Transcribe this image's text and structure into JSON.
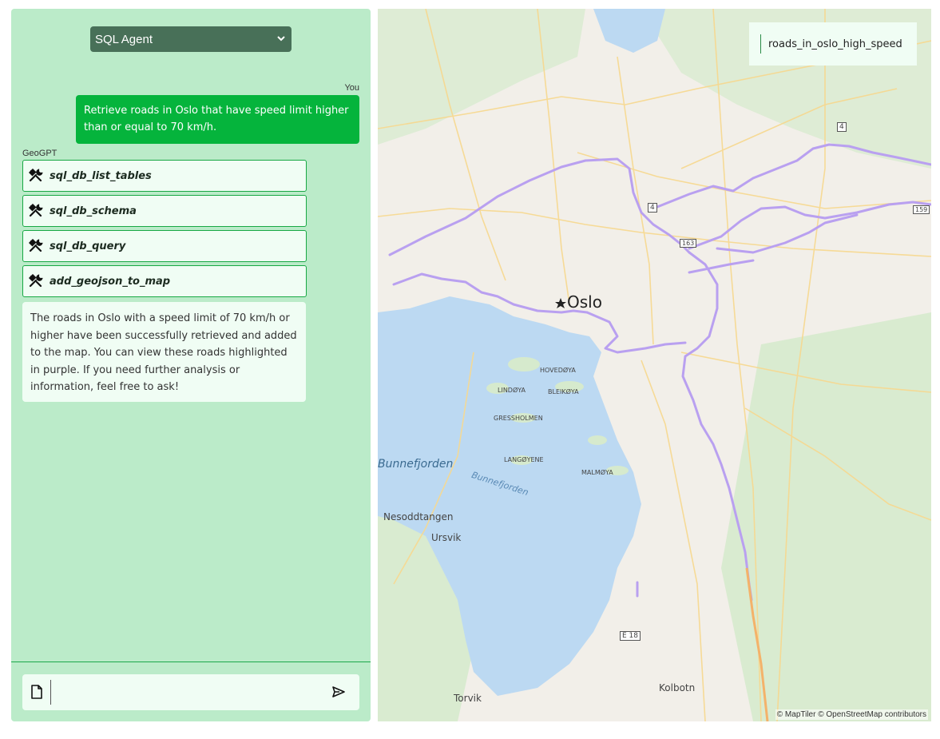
{
  "agent_select": {
    "value": "SQL Agent"
  },
  "chat": {
    "user_label": "You",
    "user_message": "Retrieve roads in Oslo that have speed limit higher than or equal to 70 km/h.",
    "bot_label": "GeoGPT",
    "tool_calls": [
      "sql_db_list_tables",
      "sql_db_schema",
      "sql_db_query",
      "add_geojson_to_map"
    ],
    "answer": "The roads in Oslo with a speed limit of 70 km/h or higher have been successfully retrieved and added to the map. You can view these roads highlighted in purple. If you need further analysis or information, feel free to ask!"
  },
  "input": {
    "placeholder": "",
    "value": ""
  },
  "map": {
    "layer_name": "roads_in_oslo_high_speed",
    "attribution": "© MapTiler © OpenStreetMap contributors",
    "highlight_color": "#b9a0f0",
    "water_color": "#bcd9f2",
    "labels": {
      "city": "Oslo",
      "bunnefjorden_big": "Bunnefjorden",
      "bunnefjorden_water": "Bunnefjorden",
      "nesoddtangen": "Nesoddtangen",
      "ursvik": "Ursvik",
      "kolbotn": "Kolbotn",
      "torvik": "Torvik",
      "hovedoya": "HOVEDØYA",
      "lindoya": "LINDØYA",
      "bleikoya": "BLEIKØYA",
      "gressholmen": "GRESSHOLMEN",
      "langoyene": "LANGØYENE",
      "malmoya": "MALMØYA",
      "road_4a": "4",
      "road_4b": "4",
      "road_163": "163",
      "road_159": "159",
      "road_e18": "E 18"
    }
  }
}
